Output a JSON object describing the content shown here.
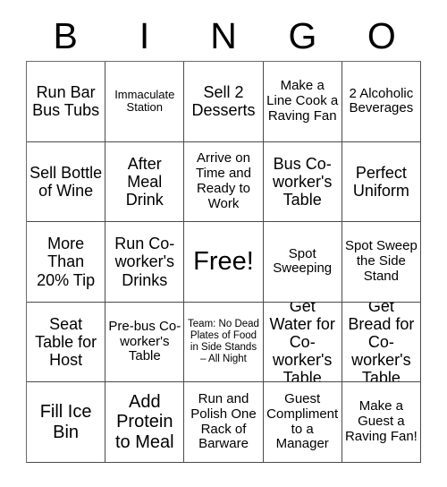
{
  "card": {
    "header_letters": [
      "B",
      "I",
      "N",
      "G",
      "O"
    ],
    "rows": [
      [
        {
          "text": "Run Bar Bus Tubs",
          "size": "fs-l",
          "free": false
        },
        {
          "text": "Immaculate Station",
          "size": "fs-s",
          "free": false
        },
        {
          "text": "Sell 2 Desserts",
          "size": "fs-l",
          "free": false
        },
        {
          "text": "Make a Line Cook a Raving Fan",
          "size": "fs-m",
          "free": false
        },
        {
          "text": "2 Alcoholic Beverages",
          "size": "fs-m",
          "free": false
        }
      ],
      [
        {
          "text": "Sell Bottle of Wine",
          "size": "fs-l",
          "free": false
        },
        {
          "text": "After Meal Drink",
          "size": "fs-l",
          "free": false
        },
        {
          "text": "Arrive on Time and Ready to Work",
          "size": "fs-m",
          "free": false
        },
        {
          "text": "Bus Co-worker's Table",
          "size": "fs-l",
          "free": false
        },
        {
          "text": "Perfect Uniform",
          "size": "fs-l",
          "free": false
        }
      ],
      [
        {
          "text": "More Than 20% Tip",
          "size": "fs-l",
          "free": false
        },
        {
          "text": "Run Co-worker's Drinks",
          "size": "fs-l",
          "free": false
        },
        {
          "text": "Free!",
          "size": "fs-xxl",
          "free": true
        },
        {
          "text": "Spot Sweeping",
          "size": "fs-m",
          "free": false
        },
        {
          "text": "Spot Sweep the Side Stand",
          "size": "fs-m",
          "free": false
        }
      ],
      [
        {
          "text": "Seat Table for Host",
          "size": "fs-l",
          "free": false
        },
        {
          "text": "Pre-bus Co-worker's Table",
          "size": "fs-m",
          "free": false
        },
        {
          "text": "Team: No Dead Plates of Food in Side Stands – All Night",
          "size": "fs-xs",
          "free": false
        },
        {
          "text": "Get Water for Co-worker's Table",
          "size": "fs-l",
          "free": false
        },
        {
          "text": "Get Bread for Co-worker's Table",
          "size": "fs-l",
          "free": false
        }
      ],
      [
        {
          "text": "Fill Ice Bin",
          "size": "fs-xl",
          "free": false
        },
        {
          "text": "Add Protein to Meal",
          "size": "fs-xl",
          "free": false
        },
        {
          "text": "Run and Polish One Rack of Barware",
          "size": "fs-m",
          "free": false
        },
        {
          "text": "Guest Compliment to a Manager",
          "size": "fs-m",
          "free": false
        },
        {
          "text": "Make a Guest a Raving Fan!",
          "size": "fs-m",
          "free": false
        }
      ]
    ]
  },
  "colors": {
    "background": "#ffffff",
    "text": "#000000",
    "grid_line": "#4a4a4a"
  }
}
